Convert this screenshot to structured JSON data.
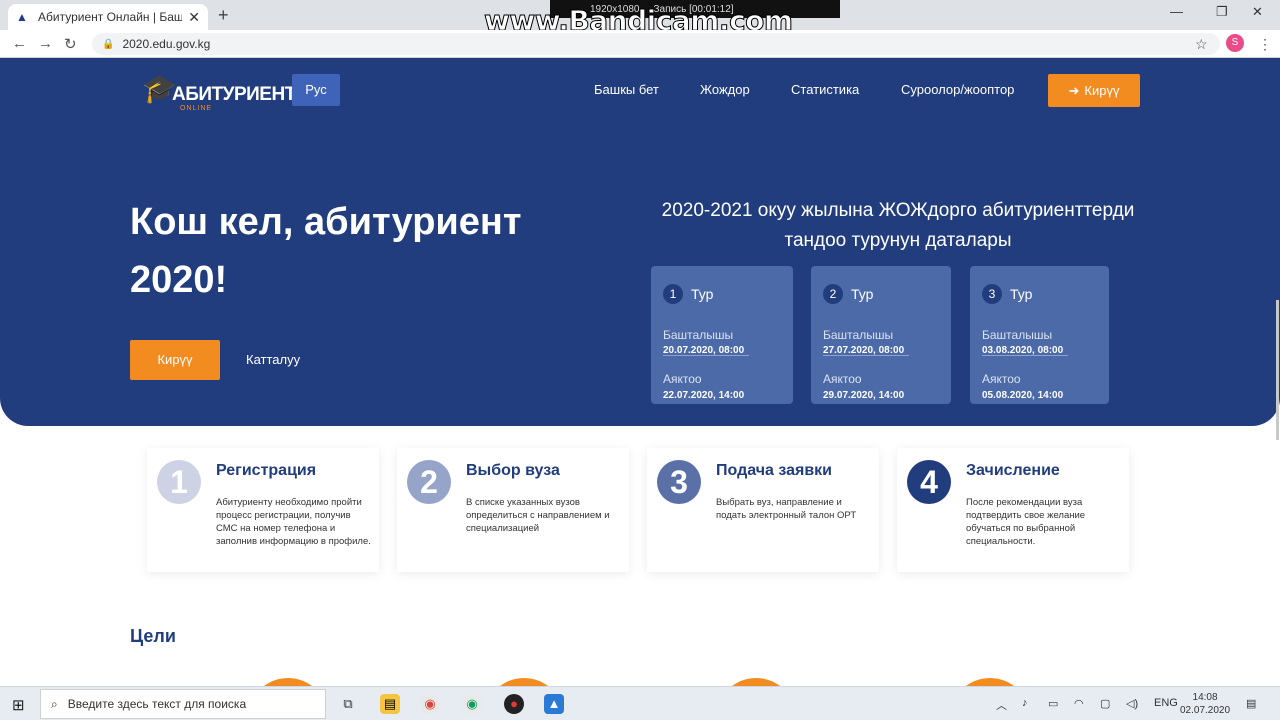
{
  "browser": {
    "tab_title": "Абитуриент Онлайн | Башкы бет",
    "tab_close": "✕",
    "new_tab": "+",
    "url": "2020.edu.gov.kg",
    "bandicam_watermark": "www.Bandicam.com",
    "bandicam_resolution": "1920x1080",
    "bandicam_record": "Запись [00:01:12]",
    "profile_initial": "S"
  },
  "header": {
    "logo_word": "АБИТУРИЕНТ",
    "logo_sub": "ONLINE",
    "logo_year": "2020",
    "lang_button": "Рус",
    "nav": [
      "Башкы бет",
      "Жождор",
      "Статистика",
      "Суроолор/жооптор"
    ],
    "login_label": "Кирүү"
  },
  "hero": {
    "title_line1": "Кош кел, абитуриент",
    "title_line2": "2020!",
    "login_button": "Кирүү",
    "register_link": "Катталуу",
    "subtitle_line1": "2020-2021 окуу жылына ЖОЖдорго абитуриенттерди",
    "subtitle_line2": "тандоо турунун даталары"
  },
  "rounds": [
    {
      "num": "1",
      "label": "Тур",
      "start_label": "Башталышы",
      "start": "20.07.2020,  08:00",
      "end_label": "Аяктоо",
      "end": "22.07.2020,  14:00"
    },
    {
      "num": "2",
      "label": "Тур",
      "start_label": "Башталышы",
      "start": "27.07.2020,  08:00",
      "end_label": "Аяктоо",
      "end": "29.07.2020,  14:00"
    },
    {
      "num": "3",
      "label": "Тур",
      "start_label": "Башталышы",
      "start": "03.08.2020,  08:00",
      "end_label": "Аяктоо",
      "end": "05.08.2020,  14:00"
    }
  ],
  "steps": [
    {
      "num": "1",
      "title": "Регистрация",
      "desc": "Абитуриенту необходимо пройти процесс регистрации, получив СМС на номер телефона и заполнив информацию в профиле.",
      "color": "#cdd3e4"
    },
    {
      "num": "2",
      "title": "Выбор вуза",
      "desc": "В списке указанных вузов определиться с направлением и специализацией",
      "color": "#95a4c8"
    },
    {
      "num": "3",
      "title": "Подача заявки",
      "desc": "Выбрать вуз, направление и подать электронный талон ОРТ",
      "color": "#5b70a6"
    },
    {
      "num": "4",
      "title": "Зачисление",
      "desc": "После рекомендации вуза подтвердить свое желание обучаться по выбранной специальности.",
      "color": "#213d7d"
    }
  ],
  "goals_heading": "Цели",
  "taskbar": {
    "search_placeholder": "Введите здесь текст для поиска",
    "lang": "ENG",
    "time": "14:08",
    "date": "02.07.2020"
  },
  "colors": {
    "primary": "#213d7d",
    "accent": "#f28c21",
    "card": "#4c6aa8"
  }
}
